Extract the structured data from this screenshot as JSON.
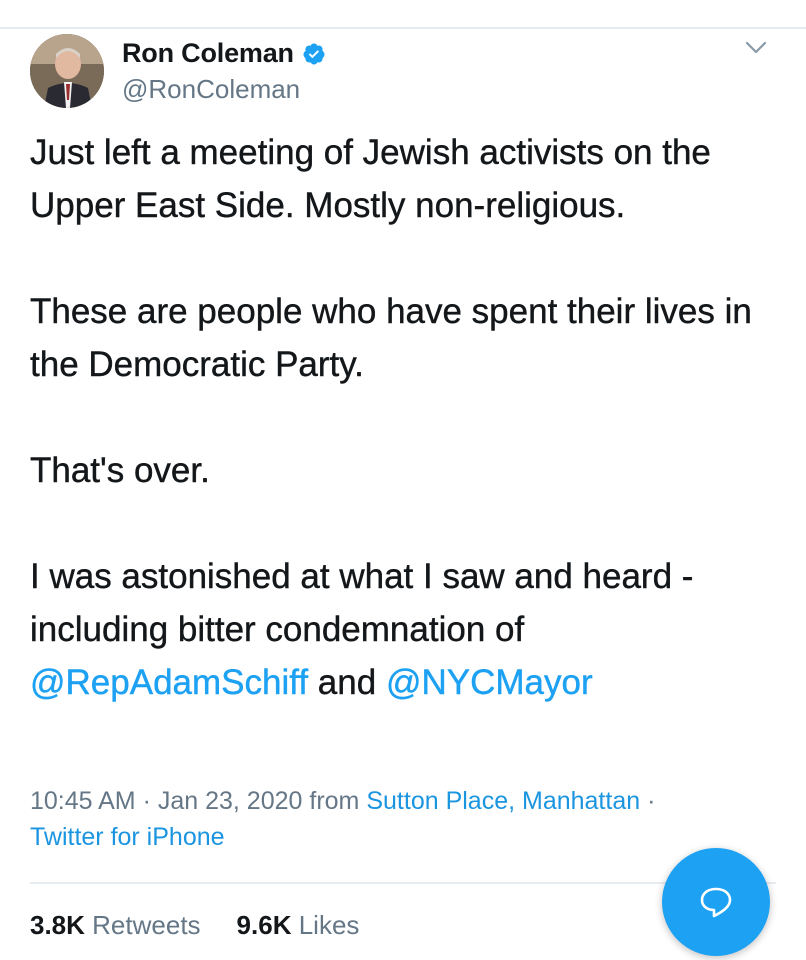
{
  "author": {
    "display_name": "Ron Coleman",
    "handle": "@RonColeman",
    "verified": true
  },
  "tweet": {
    "paragraph_1": "Just left a meeting of Jewish activists on the Upper East Side.  Mostly non-religious.",
    "paragraph_2": "These are people who have spent their lives in the Democratic Party.",
    "paragraph_3": "That's over.",
    "paragraph_4_text": "I was astonished at what I saw and heard - including bitter condemnation of ",
    "mention_1": "@RepAdamSchiff",
    "conjunction": " and ",
    "mention_2": "@NYCMayor"
  },
  "meta": {
    "time": "10:45 AM",
    "separator": " · ",
    "date": "Jan 23, 2020",
    "from_word": " from ",
    "location": "Sutton Place, Manhattan",
    "separator_2": " · ",
    "source": "Twitter for iPhone"
  },
  "stats": {
    "retweets_count": "3.8K",
    "retweets_label": "Retweets",
    "likes_count": "9.6K",
    "likes_label": "Likes"
  },
  "icons": {
    "verified": "verified-badge-icon",
    "menu": "chevron-down-icon",
    "compose": "chat-bubble-icon"
  },
  "colors": {
    "accent": "#1da1f2",
    "text": "#14171a",
    "secondary": "#657786"
  }
}
